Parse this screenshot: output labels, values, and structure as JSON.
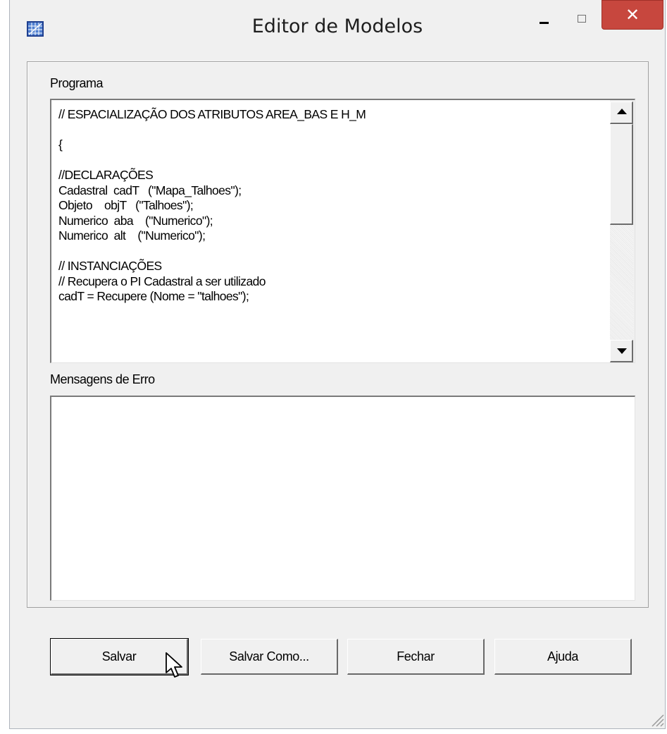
{
  "window": {
    "title": "Editor de Modelos",
    "icons": {
      "app": "grid-app-icon",
      "minimize": "minimize-icon",
      "maximize": "maximize-icon",
      "close": "close-icon"
    },
    "close_glyph": "✕"
  },
  "program": {
    "label": "Programa",
    "lines": [
      "// ESPACIALIZAÇÃO DOS ATRIBUTOS AREA_BAS E H_M",
      "",
      "{",
      "",
      "//DECLARAÇÕES",
      "Cadastral  cadT   (\"Mapa_Talhoes\");",
      "Objeto    objT   (\"Talhoes\");",
      "Numerico  aba    (\"Numerico\");",
      "Numerico  alt    (\"Numerico\");",
      "",
      "// INSTANCIAÇÕES",
      "// Recupera o PI Cadastral a ser utilizado",
      "cadT = Recupere (Nome = \"talhoes\");"
    ]
  },
  "errors": {
    "label": "Mensagens de Erro",
    "text": ""
  },
  "buttons": {
    "save": "Salvar",
    "save_as": "Salvar Como...",
    "close": "Fechar",
    "help": "Ajuda"
  },
  "colors": {
    "close_button": "#c7473e",
    "window_bg": "#f0f0f0"
  }
}
